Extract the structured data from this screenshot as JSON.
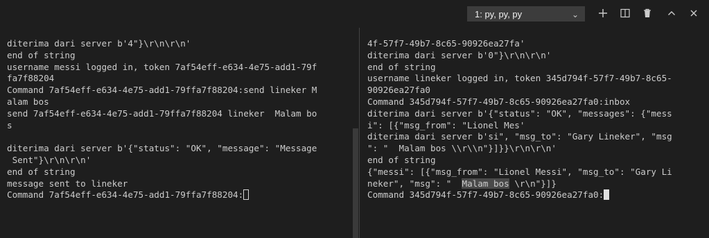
{
  "terminal_selector": {
    "label": "1: py, py, py"
  },
  "toolbar": {
    "new_icon": "plus-icon",
    "split_icon": "split-icon",
    "kill_icon": "trash-icon",
    "maximize_icon": "chevron-up-icon",
    "close_icon": "close-icon"
  },
  "left_pane": {
    "lines": [
      "diterima dari server b'4\"}\\r\\n\\r\\n'",
      "end of string",
      "username messi logged in, token 7af54eff-e634-4e75-add1-79f",
      "fa7f88204",
      "Command 7af54eff-e634-4e75-add1-79ffa7f88204:send lineker M",
      "alam bos",
      "send 7af54eff-e634-4e75-add1-79ffa7f88204 lineker  Malam bo",
      "s",
      "",
      "diterima dari server b'{\"status\": \"OK\", \"message\": \"Message",
      " Sent\"}\\r\\n\\r\\n'",
      "end of string",
      "message sent to lineker"
    ],
    "prompt": "Command 7af54eff-e634-4e75-add1-79ffa7f88204:"
  },
  "right_pane": {
    "lines": [
      "4f-57f7-49b7-8c65-90926ea27fa'",
      "diterima dari server b'0\"}\\r\\n\\r\\n'",
      "end of string",
      "username lineker logged in, token 345d794f-57f7-49b7-8c65-",
      "90926ea27fa0",
      "Command 345d794f-57f7-49b7-8c65-90926ea27fa0:inbox",
      "diterima dari server b'{\"status\": \"OK\", \"messages\": {\"mess",
      "i\": [{\"msg_from\": \"Lionel Mes'",
      "diterima dari server b'si\", \"msg_to\": \"Gary Lineker\", \"msg",
      "\": \"  Malam bos \\\\r\\\\n\"}]}}\\r\\n\\r\\n'",
      "end of string",
      "{\"messi\": [{\"msg_from\": \"Lionel Messi\", \"msg_to\": \"Gary Li"
    ],
    "last_line_prefix": "neker\", \"msg\": \"  ",
    "last_line_highlight": "Malam bos",
    "last_line_suffix": " \\r\\n\"}]}",
    "prompt": "Command 345d794f-57f7-49b7-8c65-90926ea27fa0:"
  }
}
